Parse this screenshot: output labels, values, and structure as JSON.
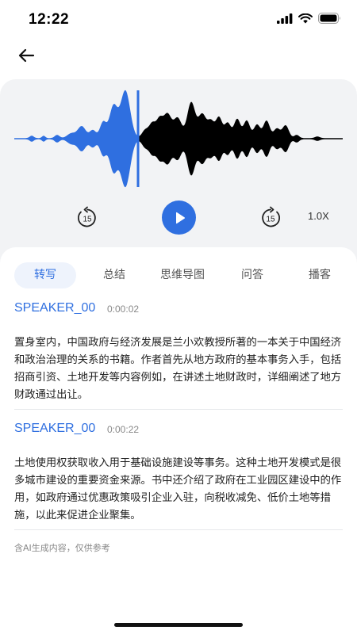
{
  "status_bar": {
    "time": "12:22"
  },
  "player": {
    "rewind_seconds": "15",
    "forward_seconds": "15",
    "speed": "1.0X"
  },
  "tabs": [
    {
      "label": "转写",
      "active": true
    },
    {
      "label": "总结",
      "active": false
    },
    {
      "label": "思维导图",
      "active": false
    },
    {
      "label": "问答",
      "active": false
    },
    {
      "label": "播客",
      "active": false
    }
  ],
  "transcript": [
    {
      "speaker": "SPEAKER_00",
      "time": "0:00:02",
      "text": "置身室内，中国政府与经济发展是兰小欢教授所著的一本关于中国经济和政治治理的关系的书籍。作者首先从地方政府的基本事务入手，包括招商引资、土地开发等内容例如，在讲述土地财政时，详细阐述了地方财政通过出让。"
    },
    {
      "speaker": "SPEAKER_00",
      "time": "0:00:22",
      "text": "土地使用权获取收入用于基础设施建设等事务。这种土地开发模式是很多城市建设的重要资金来源。书中还介绍了政府在工业园区建设中的作用，如政府通过优惠政策吸引企业入驻，向税收减免、低价土地等措施，以此来促进企业聚集。"
    }
  ],
  "disclaimer": "含AI生成内容，仅供参考",
  "colors": {
    "accent": "#2f6fe0",
    "played_wave": "#2f6fe0",
    "unplayed_wave": "#000000",
    "player_bg": "#f2f3f5"
  }
}
